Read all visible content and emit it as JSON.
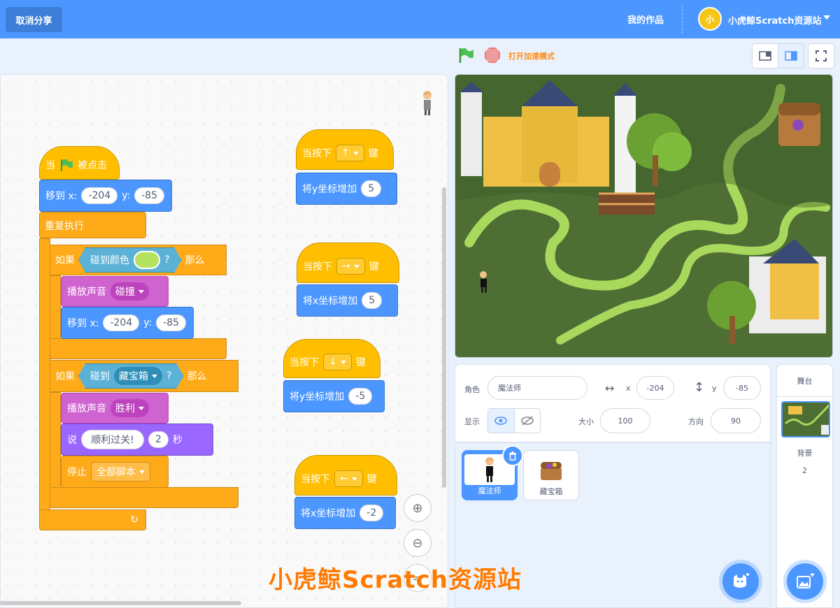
{
  "menubar": {
    "cancel_share": "取消分享",
    "my_works": "我的作品",
    "avatar_text": "小",
    "user_name": "小虎鲸Scratch资源站"
  },
  "controls": {
    "turbo": "打开加速模式"
  },
  "script_main": {
    "when_label": "当",
    "clicked_label": "被点击",
    "goto_label": "移到 x:",
    "goto_x": "-204",
    "goto_y_label": "y:",
    "goto_y": "-85",
    "forever": "重复执行",
    "if1": {
      "if_label": "如果",
      "touch_color_label": "碰到颜色",
      "q": "?",
      "then": "那么",
      "play_sound": "播放声音",
      "sound": "碰撞",
      "goto_label": "移到 x:",
      "x": "-204",
      "y_label": "y:",
      "y": "-85"
    },
    "if2": {
      "if_label": "如果",
      "touch_label": "碰到",
      "target": "藏宝箱",
      "q": "?",
      "then": "那么",
      "play_sound": "播放声音",
      "sound": "胜利",
      "say_label": "说",
      "say_text": "顺利过关!",
      "secs": "2",
      "secs_label": "秒",
      "stop_label": "停止",
      "stop_option": "全部脚本"
    }
  },
  "key_scripts": [
    {
      "when": "当按下",
      "key": "↑",
      "key_label": "键",
      "action": "将y坐标增加",
      "value": "5"
    },
    {
      "when": "当按下",
      "key": "→",
      "key_label": "键",
      "action": "将x坐标增加",
      "value": "5"
    },
    {
      "when": "当按下",
      "key": "↓",
      "key_label": "键",
      "action": "将y坐标增加",
      "value": "-5"
    },
    {
      "when": "当按下",
      "key": "←",
      "key_label": "键",
      "action": "将x坐标增加",
      "value": "-2"
    }
  ],
  "sprite_info": {
    "sprite_label": "角色",
    "sprite_name": "魔法师",
    "x_label": "x",
    "x": "-204",
    "y_label": "y",
    "y": "-85",
    "show_label": "显示",
    "size_label": "大小",
    "size": "100",
    "direction_label": "方向",
    "direction": "90"
  },
  "sprites": [
    {
      "name": "魔法师",
      "selected": true
    },
    {
      "name": "藏宝箱",
      "selected": false
    }
  ],
  "stage_pane": {
    "title": "舞台",
    "backdrops_label": "背景",
    "backdrops_count": "2"
  },
  "watermark": "小虎鲸Scratch资源站",
  "colors": {
    "menubar": "#4c97ff",
    "events": "#ffbf00",
    "motion": "#4c97ff",
    "control": "#ffab19",
    "sensing": "#5cb1d6",
    "sound": "#cf63cf",
    "looks": "#9966ff",
    "touch_color_value": "#b5e261"
  }
}
